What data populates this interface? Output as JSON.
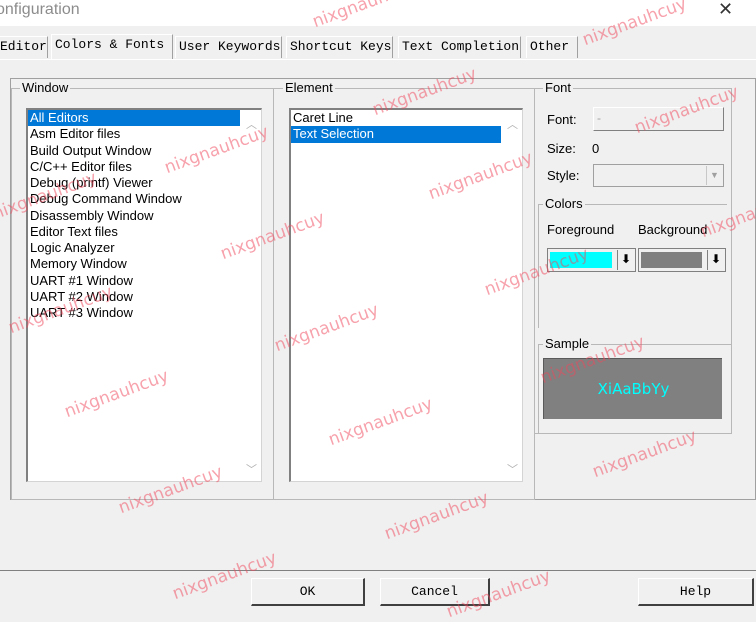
{
  "window": {
    "title": "onfiguration",
    "close_glyph": "✕"
  },
  "tabs": [
    {
      "label": "Editor",
      "active": false
    },
    {
      "label": "Colors & Fonts",
      "active": true
    },
    {
      "label": "User Keywords",
      "active": false
    },
    {
      "label": "Shortcut Keys",
      "active": false
    },
    {
      "label": "Text Completion",
      "active": false
    },
    {
      "label": "Other",
      "active": false
    }
  ],
  "window_group": {
    "legend": "Window",
    "items": [
      "All Editors",
      "Asm Editor files",
      "Build Output Window",
      "C/C++ Editor files",
      "Debug (printf) Viewer",
      "Debug Command Window",
      "Disassembly Window",
      "Editor Text files",
      "Logic Analyzer",
      "Memory Window",
      "UART #1 Window",
      "UART #2 Window",
      "UART #3 Window"
    ],
    "selected": "All Editors"
  },
  "element_group": {
    "legend": "Element",
    "items": [
      "Caret Line",
      "Text Selection"
    ],
    "selected": "Text Selection"
  },
  "font_group": {
    "legend": "Font",
    "font_label": "Font:",
    "font_button": "-",
    "size_label": "Size:",
    "size_value": "0",
    "style_label": "Style:",
    "style_value": ""
  },
  "colors_group": {
    "legend": "Colors",
    "foreground_label": "Foreground",
    "background_label": "Background",
    "foreground_color": "#00ffff",
    "background_color": "#808080",
    "dropdown_glyph": "⬇"
  },
  "sample_group": {
    "legend": "Sample",
    "text": "XiAaBbYy",
    "text_color": "#00ffff",
    "background_color": "#808080"
  },
  "buttons": {
    "ok": "OK",
    "cancel": "Cancel",
    "help": "Help"
  },
  "watermark": "nixgnauhcuy"
}
